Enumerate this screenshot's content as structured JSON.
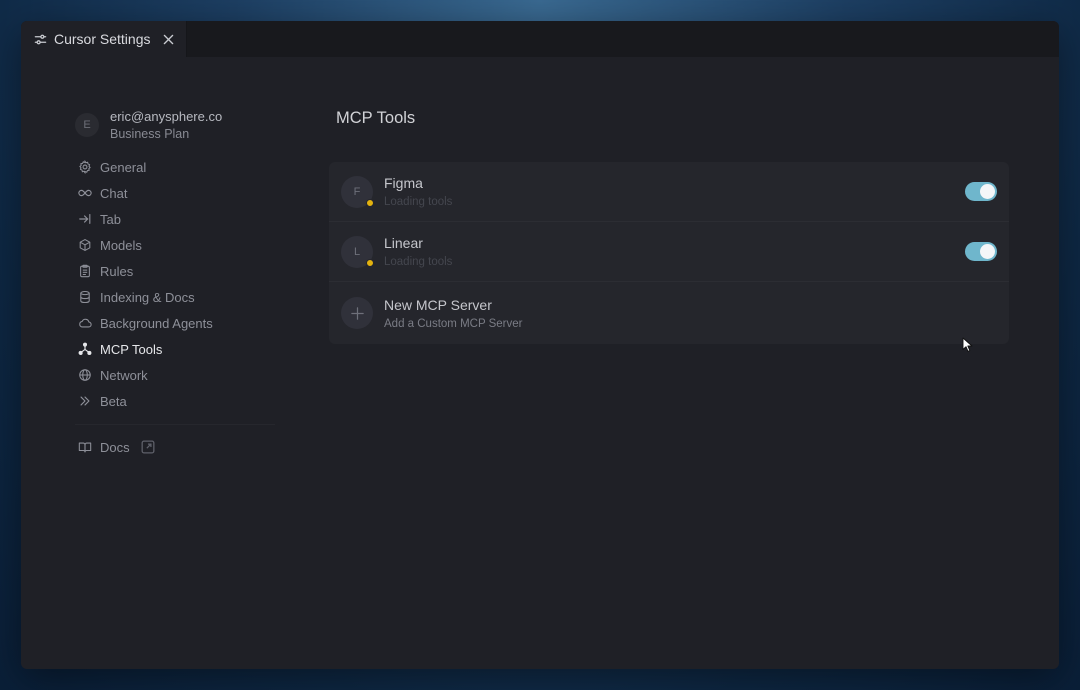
{
  "tab": {
    "title": "Cursor Settings"
  },
  "account": {
    "initial": "E",
    "email": "eric@anysphere.co",
    "plan": "Business Plan"
  },
  "nav": {
    "items": [
      {
        "label": "General",
        "icon": "gear-icon"
      },
      {
        "label": "Chat",
        "icon": "infinity-icon"
      },
      {
        "label": "Tab",
        "icon": "arrow-right-to-line-icon"
      },
      {
        "label": "Models",
        "icon": "cube-icon"
      },
      {
        "label": "Rules",
        "icon": "clipboard-icon"
      },
      {
        "label": "Indexing & Docs",
        "icon": "database-icon"
      },
      {
        "label": "Background Agents",
        "icon": "cloud-icon"
      },
      {
        "label": "MCP Tools",
        "icon": "network-nodes-icon",
        "active": true
      },
      {
        "label": "Network",
        "icon": "globe-icon"
      },
      {
        "label": "Beta",
        "icon": "double-chevron-right-icon"
      }
    ],
    "docs": {
      "label": "Docs",
      "icon": "book-icon"
    }
  },
  "page": {
    "title": "MCP Tools"
  },
  "servers": [
    {
      "initial": "F",
      "name": "Figma",
      "status": "Loading tools",
      "enabled": true,
      "status_color": "#e3b20f"
    },
    {
      "initial": "L",
      "name": "Linear",
      "status": "Loading tools",
      "enabled": true,
      "status_color": "#e3b20f"
    }
  ],
  "new_server": {
    "name": "New MCP Server",
    "subtitle": "Add a Custom MCP Server"
  },
  "colors": {
    "accent_toggle": "#6fb6cc",
    "status_loading": "#e3b20f"
  }
}
